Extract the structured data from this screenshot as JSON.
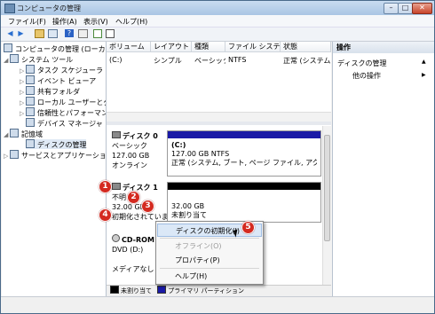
{
  "window": {
    "title": "コンピュータの管理",
    "min": "–",
    "max": "□",
    "close": "✕"
  },
  "menu": [
    "ファイル(F)",
    "操作(A)",
    "表示(V)",
    "ヘルプ(H)"
  ],
  "toolbar_icons": [
    "back-icon",
    "forward-icon",
    "up-folder-icon",
    "show-hide-tree-icon",
    "help-icon",
    "properties-icon",
    "export-icon",
    "refresh-icon"
  ],
  "tree": [
    {
      "label": "コンピュータの管理 (ローカル)",
      "icon": "computer-management-icon"
    },
    {
      "label": "システム ツール",
      "icon": "tools-icon"
    },
    {
      "label": "タスク スケジューラ",
      "icon": "task-scheduler-icon"
    },
    {
      "label": "イベント ビューア",
      "icon": "event-viewer-icon"
    },
    {
      "label": "共有フォルダ",
      "icon": "shared-folder-icon"
    },
    {
      "label": "ローカル ユーザーとグループ",
      "icon": "users-icon"
    },
    {
      "label": "信頼性とパフォーマンス",
      "icon": "performance-icon"
    },
    {
      "label": "デバイス マネージャ",
      "icon": "device-manager-icon"
    },
    {
      "label": "記憶域",
      "icon": "storage-icon"
    },
    {
      "label": "ディスクの管理",
      "icon": "disk-management-icon"
    },
    {
      "label": "サービスとアプリケーション",
      "icon": "services-icon"
    }
  ],
  "volume_list": {
    "columns": [
      "ボリューム",
      "レイアウト",
      "種類",
      "ファイル システム",
      "状態"
    ],
    "rows": [
      [
        "(C:)",
        "シンプル",
        "ベーシック",
        "NTFS",
        "正常 (システム, ブー"
      ]
    ]
  },
  "disks": {
    "disk0": {
      "name": "ディスク 0",
      "type": "ベーシック",
      "size": "127.00 GB",
      "status": "オンライン",
      "volume": {
        "name": "(C:)",
        "size": "127.00 GB NTFS",
        "status": "正常 (システム, ブート, ページ ファイル, アクティ"
      }
    },
    "disk1": {
      "name": "ディスク 1",
      "type": "不明",
      "size": "32.00 GB",
      "status": "初期化されていません",
      "volume": {
        "size": "32.00 GB",
        "status": "未割り当て"
      }
    },
    "cdrom": {
      "name": "CD-ROM",
      "drive": "DVD (D:)",
      "status": "メディアなし"
    }
  },
  "legend": [
    {
      "label": "未割り当て",
      "color": "#000000"
    },
    {
      "label": "プライマリ パーティション",
      "color": "#1a1aa6"
    }
  ],
  "actions": {
    "header": "操作",
    "section": "ディスクの管理",
    "items": [
      "他の操作"
    ]
  },
  "context_menu": [
    "ディスクの初期化(I)",
    "オフライン(O)",
    "プロパティ(P)",
    "ヘルプ(H)"
  ],
  "badges": [
    "1",
    "2",
    "3",
    "4",
    "5"
  ]
}
